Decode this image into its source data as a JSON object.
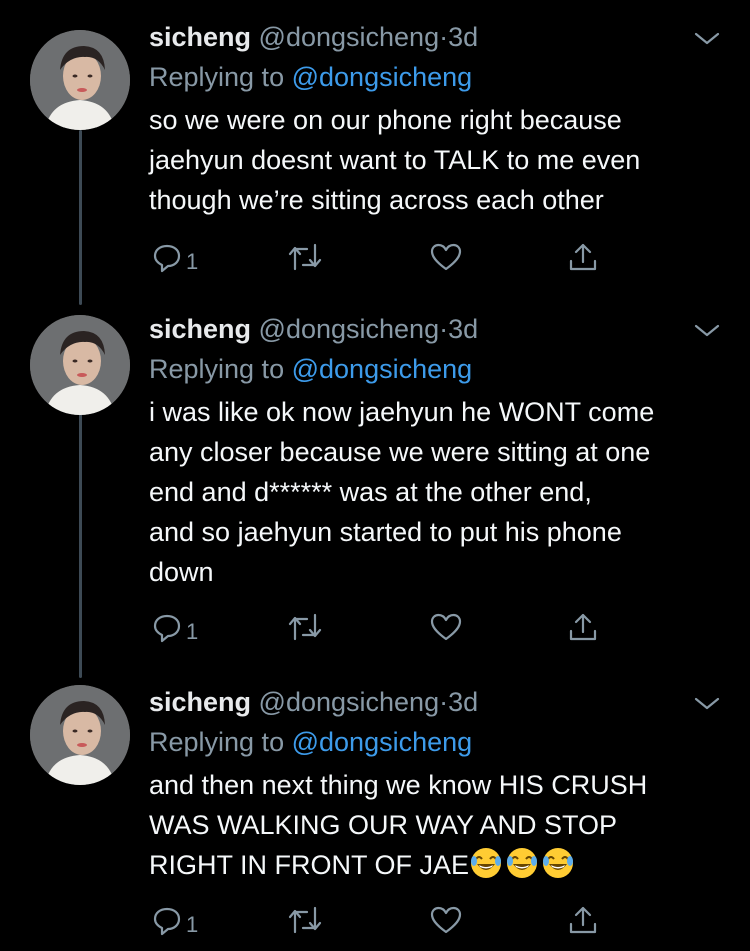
{
  "tweets": [
    {
      "name": "sicheng",
      "handle": "@dongsicheng",
      "separator": "·",
      "time": "3d",
      "replying_prefix": "Replying to",
      "replying_to": "@dongsicheng",
      "text": "so we were on our phone right because\njaehyun doesnt want to TALK to me even\nthough we’re sitting across each other",
      "reply_count": "1"
    },
    {
      "name": "sicheng",
      "handle": "@dongsicheng",
      "separator": "·",
      "time": "3d",
      "replying_prefix": "Replying to",
      "replying_to": "@dongsicheng",
      "text": "i was like ok now jaehyun he WONT come\nany closer because we were sitting at one\nend and d****** was at the other end,\nand so jaehyun started to put his phone\ndown",
      "reply_count": "1"
    },
    {
      "name": "sicheng",
      "handle": "@dongsicheng",
      "separator": "·",
      "time": "3d",
      "replying_prefix": "Replying to",
      "replying_to": "@dongsicheng",
      "text": "and then next thing we know HIS CRUSH\nWAS WALKING OUR WAY AND STOP\nRIGHT IN FRONT OF JAE",
      "text_emoji": [
        "face-with-tears-of-joy",
        "face-with-tears-of-joy",
        "face-with-tears-of-joy"
      ],
      "reply_count": "1"
    }
  ],
  "icons": {
    "reply": "reply-icon",
    "retweet": "retweet-icon",
    "like": "heart-icon",
    "share": "share-icon",
    "menu": "chevron-down-icon"
  },
  "colors": {
    "background": "#000000",
    "name": "#e8eaec",
    "secondary": "#8899a6",
    "mention": "#3d9bea",
    "thread_line": "#3d4a55"
  }
}
